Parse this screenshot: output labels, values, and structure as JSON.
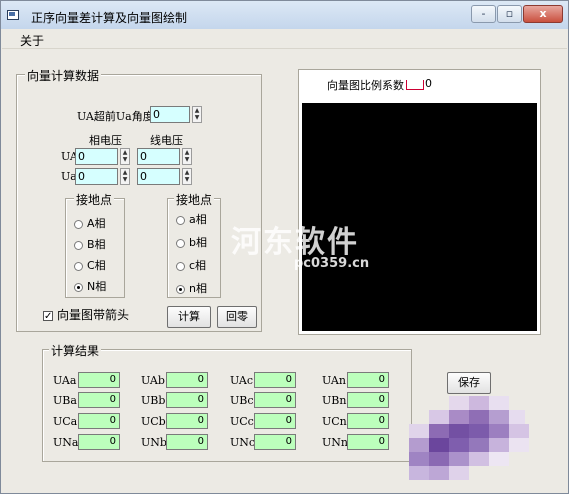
{
  "window": {
    "title": "正序向量差计算及向量图绘制",
    "min_glyph": "-",
    "max_glyph": "▫",
    "close_glyph": "x"
  },
  "menu": {
    "items": [
      "关于"
    ]
  },
  "calc_group": {
    "legend": "向量计算数据",
    "angle_label": "UA超前Ua角度",
    "angle_value": "0",
    "phase_voltage_header": "相电压",
    "line_voltage_header": "线电压",
    "rows": [
      {
        "label": "UA",
        "phase_value": "0",
        "line_value": "0"
      },
      {
        "label": "Ua",
        "phase_value": "0",
        "line_value": "0"
      }
    ],
    "ground_left": {
      "legend": "接地点",
      "options": [
        {
          "label": "A相",
          "checked": false
        },
        {
          "label": "B相",
          "checked": false
        },
        {
          "label": "C相",
          "checked": false
        },
        {
          "label": "N相",
          "checked": true
        }
      ]
    },
    "ground_right": {
      "legend": "接地点",
      "options": [
        {
          "label": "a相",
          "checked": false
        },
        {
          "label": "b相",
          "checked": false
        },
        {
          "label": "c相",
          "checked": false
        },
        {
          "label": "n相",
          "checked": true
        }
      ]
    },
    "arrow_checkbox_label": "向量图带箭头",
    "arrow_checked": true,
    "calc_button": "计算",
    "reset_button": "回零"
  },
  "vector_panel": {
    "scale_label": "向量图比例系数",
    "scale_value": "0"
  },
  "result_group": {
    "legend": "计算结果",
    "rows": [
      [
        {
          "label": "UAa",
          "value": "0"
        },
        {
          "label": "UAb",
          "value": "0"
        },
        {
          "label": "UAc",
          "value": "0"
        },
        {
          "label": "UAn",
          "value": "0"
        }
      ],
      [
        {
          "label": "UBa",
          "value": "0"
        },
        {
          "label": "UBb",
          "value": "0"
        },
        {
          "label": "UBc",
          "value": "0"
        },
        {
          "label": "UBn",
          "value": "0"
        }
      ],
      [
        {
          "label": "UCa",
          "value": "0"
        },
        {
          "label": "UCb",
          "value": "0"
        },
        {
          "label": "UCc",
          "value": "0"
        },
        {
          "label": "UCn",
          "value": "0"
        }
      ],
      [
        {
          "label": "UNa",
          "value": "0"
        },
        {
          "label": "UNb",
          "value": "0"
        },
        {
          "label": "UNc",
          "value": "0"
        },
        {
          "label": "UNn",
          "value": "0"
        }
      ]
    ]
  },
  "save_button": "保存",
  "watermark": {
    "text": "河东软件",
    "url": "pc0359.cn"
  }
}
